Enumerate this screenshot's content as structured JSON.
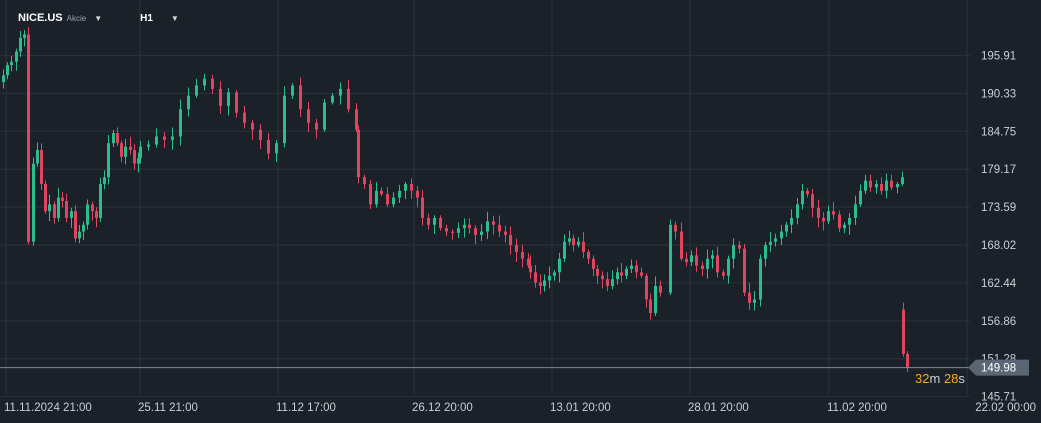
{
  "header": {
    "symbol": "NICE.US",
    "instrument_type": "Akcie",
    "timeframe": "H1"
  },
  "countdown": {
    "minutes": "32",
    "minutes_unit": "m",
    "seconds": "28",
    "seconds_unit": "s"
  },
  "colors": {
    "background": "#1a2129",
    "up": "#2bbd8b",
    "down": "#e0455f",
    "grid": "#29323c",
    "price_line": "#7f8b99",
    "price_tag": "#5a6674"
  },
  "chart_data": {
    "type": "candlestick",
    "instrument": "NICE.US",
    "timeframe": "H1",
    "ylim": [
      145.71,
      199.5
    ],
    "y_ticks": [
      "195.91",
      "190.33",
      "184.75",
      "179.17",
      "173.59",
      "168.02",
      "162.44",
      "156.86",
      "151.28",
      "145.71"
    ],
    "x_ticks": [
      "11.11.2024  21:00",
      "25.11  21:00",
      "11.12  17:00",
      "26.12  20:00",
      "13.01  20:00",
      "28.01  20:00",
      "11.02  20:00",
      "22.02  00:00"
    ],
    "last_price": "149.98",
    "grid": true,
    "series": [
      {
        "segment": "11.11.2024 – 25.11",
        "closes": [
          193,
          194.5,
          195,
          196.5,
          198.5,
          199,
          168.5,
          180,
          182,
          177,
          173,
          174,
          172,
          175,
          174.5,
          172,
          173,
          169,
          170,
          171,
          174,
          173,
          172,
          177,
          178,
          183,
          184.5,
          183,
          181,
          182.5,
          182,
          180,
          180.8
        ]
      },
      {
        "segment": "25.11 – 11.12",
        "closes": [
          182.5,
          182.8,
          184,
          183.5,
          184,
          188,
          190,
          191.5,
          192.5,
          191,
          188.5,
          190.5,
          187.5,
          186,
          185,
          183.5,
          181.5,
          183,
          190,
          191.5,
          188,
          186,
          185,
          189,
          190,
          191,
          188,
          185
        ]
      },
      {
        "segment": "11.12 – 26.12",
        "closes": [
          178,
          177,
          174,
          176,
          175.5,
          174,
          175,
          176,
          177,
          176,
          175,
          172,
          171,
          172,
          170.5,
          170,
          169.8,
          170.5,
          171,
          170.5,
          169.5,
          170,
          171.5,
          171,
          170,
          169.5,
          168,
          167,
          166,
          165
        ]
      },
      {
        "segment": "26.12 – 13.01",
        "closes": [
          164,
          162.5,
          162,
          162.8,
          163.5,
          164,
          166,
          168.5,
          169,
          168,
          168.5,
          167,
          166,
          164.5,
          163.5,
          163,
          162,
          163,
          164,
          163.5,
          164.5,
          165,
          164,
          163.5,
          160,
          158,
          162,
          161
        ]
      },
      {
        "segment": "28.01 – 22.02",
        "closes": [
          171,
          170,
          166,
          165.5,
          166.5,
          165,
          164.5,
          166,
          166.5,
          164,
          163.5,
          166,
          168,
          167.5,
          161,
          159.5,
          160,
          166,
          168,
          168.5,
          169,
          170,
          171,
          172,
          174,
          176,
          175.5,
          173.5,
          172,
          171.5,
          173,
          172.5,
          170.5,
          171,
          172,
          174,
          176,
          177.5,
          176.5,
          177,
          176,
          177.5,
          176.5,
          177,
          178
        ]
      },
      {
        "segment": "22.02",
        "closes": [
          152,
          149.98
        ]
      }
    ]
  }
}
